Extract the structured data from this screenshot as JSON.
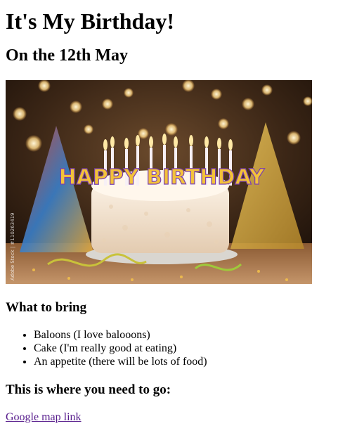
{
  "header": {
    "title": "It's My Birthday!",
    "date_heading": "On the 12th May"
  },
  "image": {
    "cake_text": "HAPPY BIRTHDAY",
    "watermark": "Adobe Stock | #110263419"
  },
  "bring": {
    "heading": "What to bring",
    "items": [
      "Baloons (I love balooons)",
      "Cake (I'm really good at eating)",
      "An appetite (there will be lots of food)"
    ]
  },
  "location": {
    "heading": "This is where you need to go:",
    "link_text": "Google map link"
  },
  "colors": {
    "link_visited": "#551a8b",
    "text": "#000000",
    "background": "#ffffff"
  }
}
